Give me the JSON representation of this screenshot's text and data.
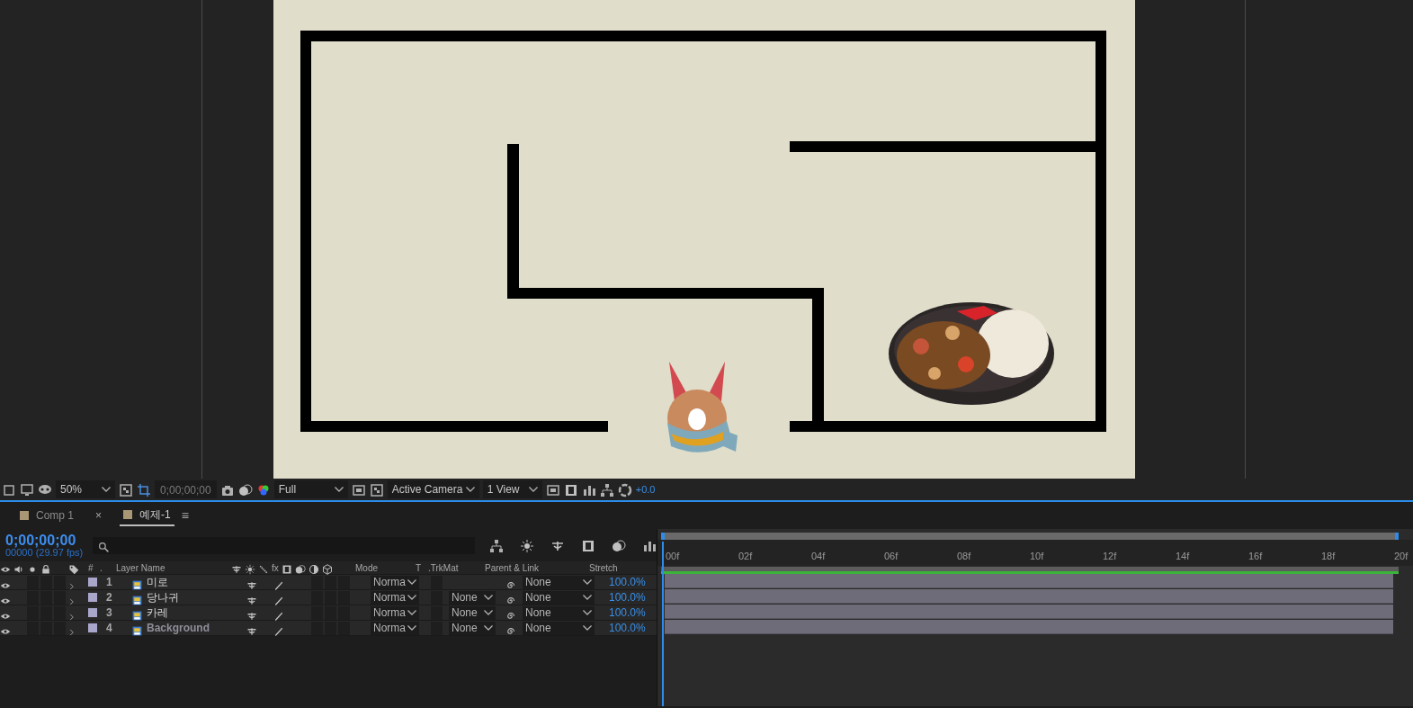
{
  "viewer": {
    "zoom": "50%",
    "timecode": "0;00;00;00",
    "resolution": "Full",
    "camera": "Active Camera",
    "views": "1 View",
    "exposure": "+0.0"
  },
  "tabs": [
    {
      "label": "Comp 1",
      "selected": false,
      "color": "#a89674"
    },
    {
      "label": "예제-1",
      "selected": true,
      "color": "#a89674",
      "close": "×",
      "menu": "≡"
    }
  ],
  "timeline": {
    "current_time": "0;00;00;00",
    "frame_info": "00000 (29.97 fps)",
    "columns": {
      "number": "#",
      "dot": ".",
      "layer_name": "Layer Name",
      "fx": "fx",
      "mode": "Mode",
      "t": "T",
      "trkmat": ".TrkMat",
      "parent": "Parent & Link",
      "stretch": "Stretch"
    },
    "ruler": [
      "00f",
      "02f",
      "04f",
      "06f",
      "08f",
      "10f",
      "12f",
      "14f",
      "16f",
      "18f",
      "20f"
    ],
    "layers": [
      {
        "number": "1",
        "name": "미로",
        "emphasis": false,
        "color": "#a9a6cc",
        "mode": "Norma",
        "parent": "None",
        "stretch": "100.0%"
      },
      {
        "number": "2",
        "name": "당나귀",
        "emphasis": false,
        "color": "#a9a6cc",
        "mode": "Norma",
        "trkmat": "None",
        "parent": "None",
        "stretch": "100.0%"
      },
      {
        "number": "3",
        "name": "카레",
        "emphasis": false,
        "color": "#a9a6cc",
        "mode": "Norma",
        "trkmat": "None",
        "parent": "None",
        "stretch": "100.0%"
      },
      {
        "number": "4",
        "name": "Background",
        "emphasis": true,
        "color": "#a9a6cc",
        "mode": "Norma",
        "trkmat": "None",
        "parent": "None",
        "stretch": "100.0%"
      }
    ]
  }
}
